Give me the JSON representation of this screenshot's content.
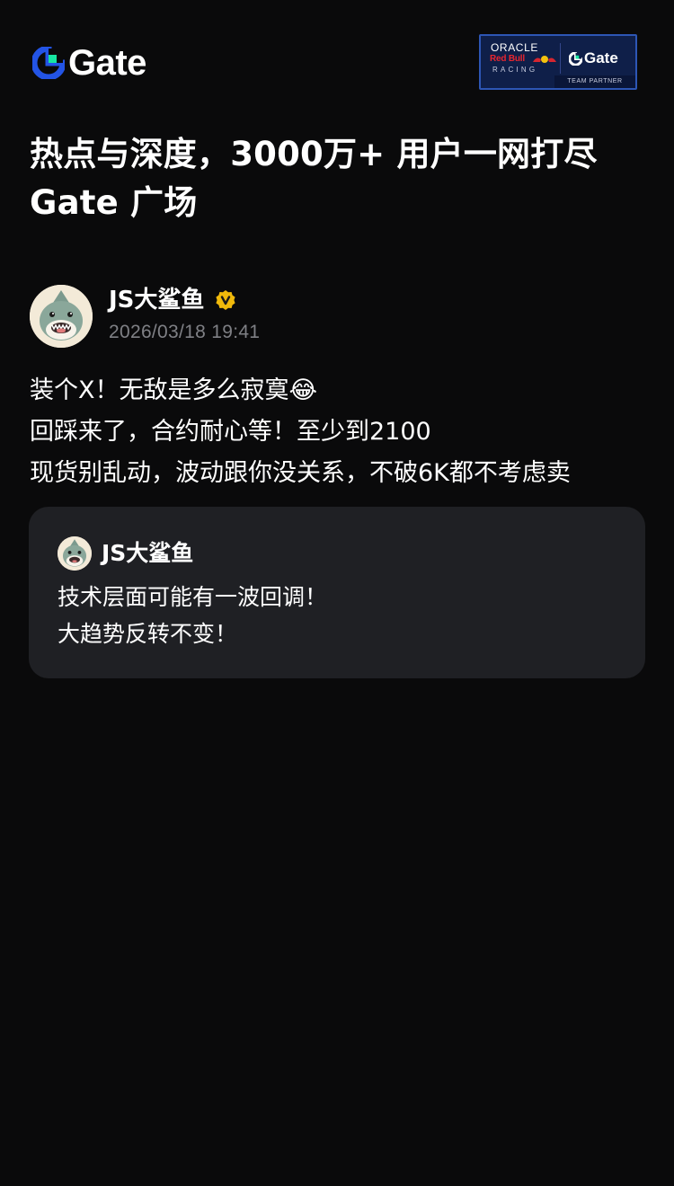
{
  "header": {
    "logo_text": "Gate",
    "partner_badge": {
      "oracle": "ORACLE",
      "redbull": "Red Bull",
      "racing": "RACING",
      "gate": "Gate",
      "team_partner": "TEAM PARTNER"
    }
  },
  "headline": {
    "line1": "热点与深度，3000万+ 用户一网打尽",
    "line2": "Gate 广场"
  },
  "post": {
    "author": "JS大鲨鱼",
    "verified_icon": "verified-badge-icon",
    "time": "2026/03/18 19:41",
    "lines": [
      "装个X！无敌是多么寂寞😂",
      "回踩来了，合约耐心等！至少到2100",
      "现货别乱动，波动跟你没关系，不破6K都不考虑卖"
    ],
    "quote": {
      "author": "JS大鲨鱼",
      "lines": [
        "技术层面可能有一波回调！",
        "大趋势反转不变！"
      ]
    }
  },
  "colors": {
    "background": "#0a0a0b",
    "card": "#1f2024",
    "muted_text": "#7f8085",
    "brand_blue": "#2354e6",
    "brand_green": "#17e6a1",
    "verified_gold": "#f0b90b"
  }
}
